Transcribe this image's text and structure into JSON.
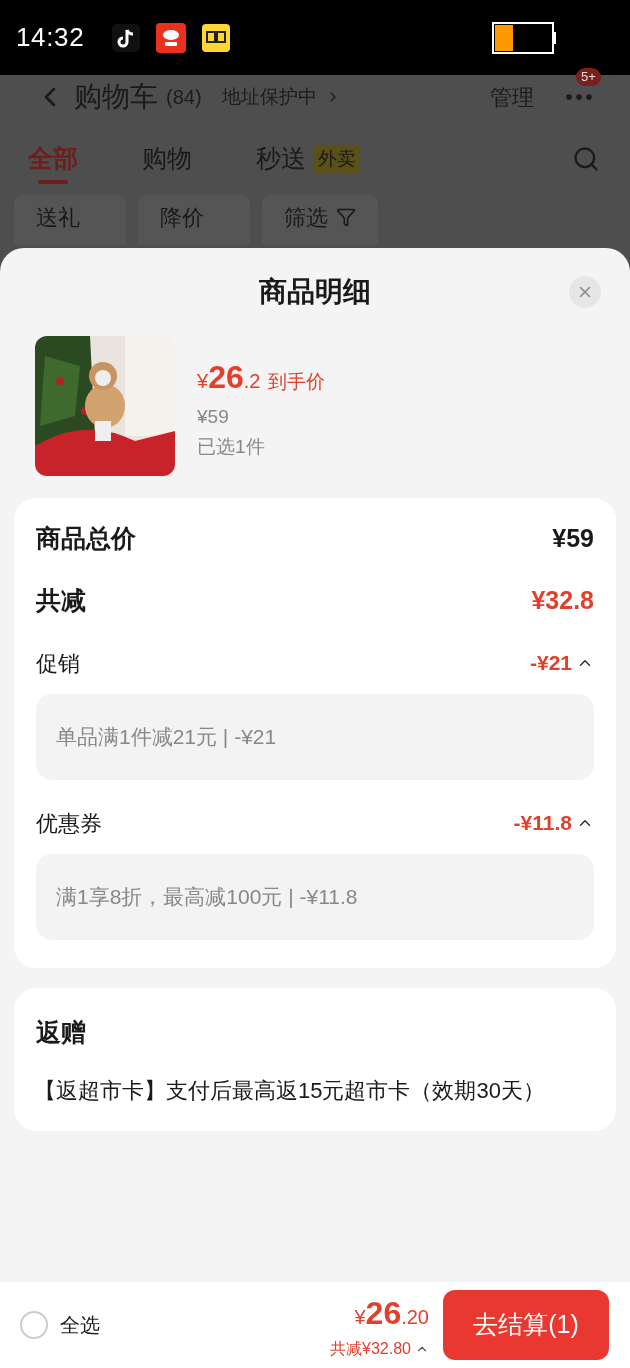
{
  "status_bar": {
    "time": "14:32"
  },
  "cart_header": {
    "title": "购物车",
    "count": "(84)",
    "address": "地址保护中",
    "manage": "管理",
    "badge": "5+"
  },
  "tabs": [
    {
      "label": "全部",
      "selected": true
    },
    {
      "label": "购物",
      "selected": false
    },
    {
      "label": "秒送",
      "tag": "外卖",
      "selected": false
    }
  ],
  "filters": [
    {
      "label": "送礼",
      "kind": "plain"
    },
    {
      "label": "降价",
      "kind": "plain"
    },
    {
      "label": "筛选",
      "kind": "filter"
    }
  ],
  "sheet": {
    "title": "商品明细",
    "product": {
      "currency": "¥",
      "price_int": "26",
      "price_dec": ".2",
      "price_label": "到手价",
      "original_price": "¥59",
      "selected_count": "已选1件"
    },
    "summary": [
      {
        "kind": "total",
        "label": "商品总价",
        "value": "¥59"
      },
      {
        "kind": "discount",
        "label": "共减",
        "value": "¥32.8"
      },
      {
        "kind": "section",
        "label": "促销",
        "value": "-¥21",
        "expanded": true,
        "detail": "单品满1件减21元 | -¥21"
      },
      {
        "kind": "section",
        "label": "优惠券",
        "value": "-¥11.8",
        "expanded": true,
        "detail": "满1享8折，最高减100元 | -¥11.8"
      }
    ],
    "gift": {
      "title": "返赠",
      "text": "【返超市卡】支付后最高返15元超市卡（效期30天）"
    }
  },
  "bottom_bar": {
    "select_all": {
      "label": "全选",
      "checked": false
    },
    "currency": "¥",
    "total_int": "26",
    "total_dec": ".20",
    "discount": "共减¥32.80",
    "checkout": "去结算(1)"
  }
}
